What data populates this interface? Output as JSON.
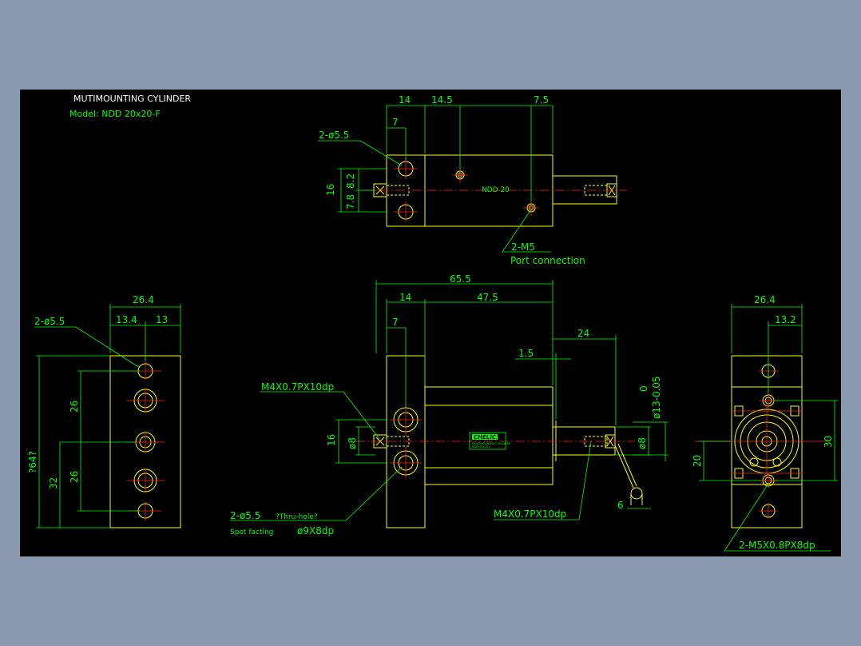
{
  "title": "MUTIMOUNTING CYLINDER",
  "model": "Model: NDD 20x20-F",
  "badge": {
    "brand": "CHELIC",
    "line1": "NDD 20x20-F",
    "line2": "MULTIMOUNTING CYLINDER"
  },
  "top_view": {
    "dims": [
      "14",
      "14.5",
      "7.5",
      "7",
      "2-ø5.5",
      "16",
      "7.8",
      "8.2"
    ],
    "port_label": "2-M5",
    "port_desc": "Port connection",
    "body_text": "NDD 20"
  },
  "left_view": {
    "dims": [
      "26.4",
      "13.4",
      "13",
      "2-ø5.5",
      "26",
      "26",
      "32",
      "?64?"
    ]
  },
  "front_view": {
    "dims": [
      "65.5",
      "14",
      "47.5",
      "7",
      "24",
      "1.5",
      "16",
      "ø8",
      "ø8",
      "0",
      "ø13-0.05",
      "6"
    ],
    "callout_tap_left": "M4X0.7PX10dp",
    "callout_tap_right": "M4X0.7PX10dp",
    "callout_hole": "2-ø5.5",
    "callout_hole_note": "?Thru-hole?",
    "callout_spot": "Spot facting",
    "callout_spot_size": "ø9X8dp"
  },
  "right_view": {
    "dims": [
      "26.4",
      "13.2",
      "30",
      "20"
    ],
    "callout": "2-M5X0.8PX8dp"
  },
  "colors": {
    "outline": "#ffff00",
    "dimension": "#00ff00",
    "centerline": "#ff2020",
    "background": "#000000",
    "frame": "#8a9aae"
  }
}
